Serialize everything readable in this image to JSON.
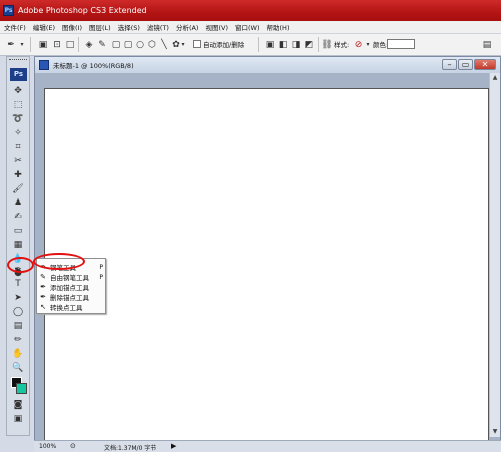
{
  "window": {
    "title": "Adobe Photoshop CS3 Extended",
    "app_icon": "Ps"
  },
  "menu": [
    "文件(F)",
    "编辑(E)",
    "图像(I)",
    "图层(L)",
    "选择(S)",
    "滤镜(T)",
    "分析(A)",
    "视图(V)",
    "窗口(W)",
    "帮助(H)"
  ],
  "options": {
    "auto_add_delete": "自动添加/删除",
    "style_label": "样式:",
    "color_label": "颜色:"
  },
  "tools": {
    "logo": "Ps"
  },
  "document": {
    "title": "未标题-1 @ 100%(RGB/8)"
  },
  "status": {
    "zoom": "100%",
    "doc_info": "文档:1.37M/0 字节"
  },
  "flyout": {
    "items": [
      {
        "label": "钢笔工具",
        "shortcut": "P"
      },
      {
        "label": "自由钢笔工具",
        "shortcut": "P"
      },
      {
        "label": "添加锚点工具",
        "shortcut": ""
      },
      {
        "label": "删除锚点工具",
        "shortcut": ""
      },
      {
        "label": "转换点工具",
        "shortcut": ""
      }
    ]
  },
  "colors": {
    "foreground": "#111111",
    "background": "#15c6a0",
    "annotation": "#e31010",
    "titlebar": "#b31414"
  }
}
